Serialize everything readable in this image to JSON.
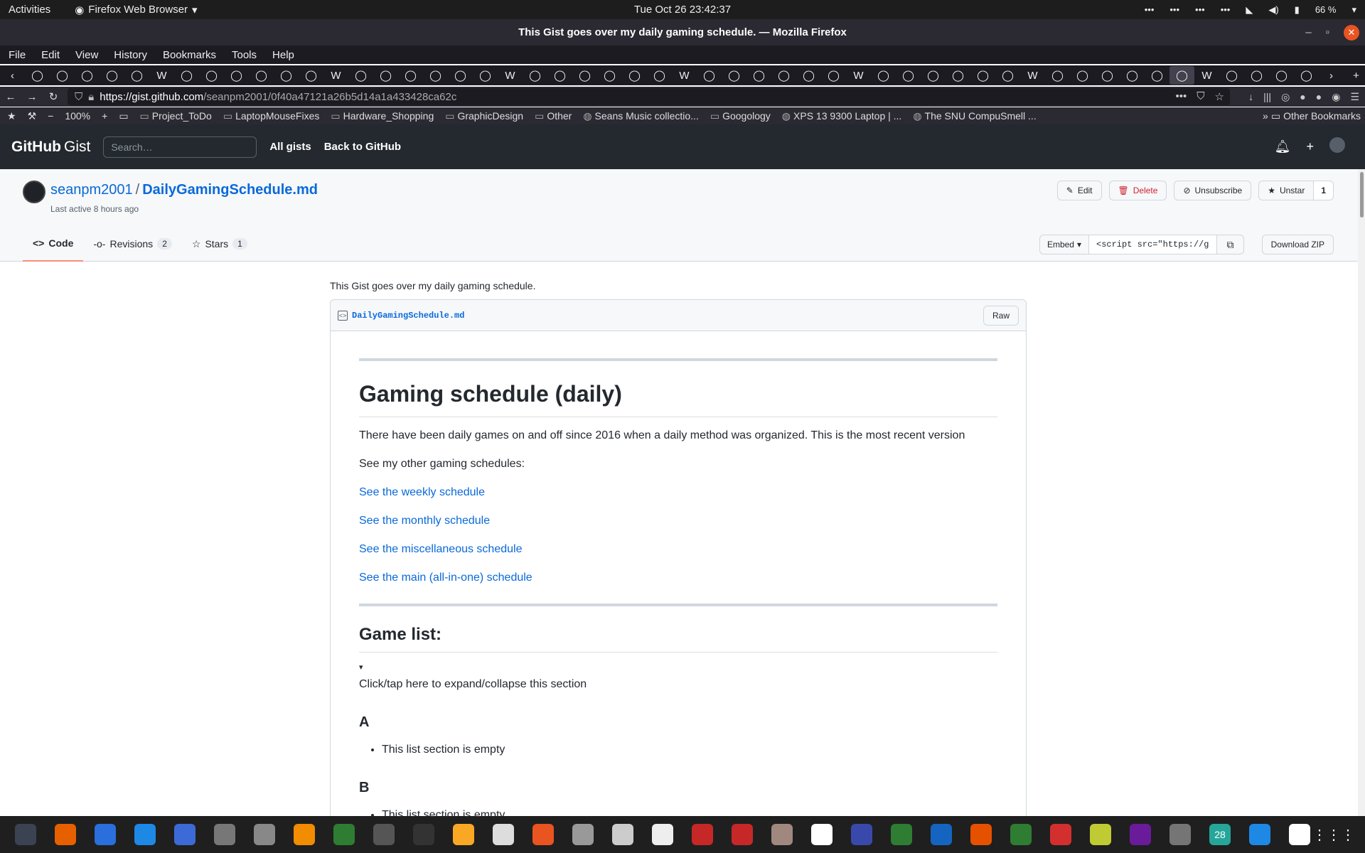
{
  "system": {
    "activities": "Activities",
    "app_name": "Firefox Web Browser",
    "clock": "Tue Oct 26  23:42:37",
    "battery": "66 %"
  },
  "window": {
    "title": "This Gist goes over my daily gaming schedule. — Mozilla Firefox"
  },
  "menu": [
    "File",
    "Edit",
    "View",
    "History",
    "Bookmarks",
    "Tools",
    "Help"
  ],
  "tabs": {
    "count_icons": 52,
    "active_index": 46
  },
  "navbar": {
    "url_host": "https://gist.github.com",
    "url_path": "/seanpm2001/0f40a47121a26b5d14a1a433428ca62c",
    "zoom": "100%"
  },
  "bookmarks": [
    "Project_ToDo",
    "LaptopMouseFixes",
    "Hardware_Shopping",
    "GraphicDesign",
    "Other",
    "Seans Music collectio...",
    "Googology",
    "XPS 13 9300 Laptop | ...",
    "The SNU CompuSmell ..."
  ],
  "other_bookmarks": "Other Bookmarks",
  "github": {
    "logo_main": "GitHub",
    "logo_sub": "Gist",
    "search_placeholder": "Search…",
    "nav": [
      "All gists",
      "Back to GitHub"
    ]
  },
  "gist": {
    "owner": "seanpm2001",
    "separator": "/",
    "filename": "DailyGamingSchedule.md",
    "last_active": "Last active 8 hours ago",
    "buttons": {
      "edit": "Edit",
      "delete": "Delete",
      "unsubscribe": "Unsubscribe",
      "unstar": "Unstar",
      "star_count": "1"
    },
    "tabs": {
      "code": "Code",
      "revisions": "Revisions",
      "revisions_count": "2",
      "stars": "Stars",
      "stars_count": "1"
    },
    "embed_label": "Embed",
    "embed_value": "<script src=\"https://g",
    "download_zip": "Download ZIP",
    "description": "This Gist goes over my daily gaming schedule.",
    "file_name_mono": "DailyGamingSchedule.md",
    "raw": "Raw"
  },
  "markdown": {
    "h1": "Gaming schedule (daily)",
    "intro": "There have been daily games on and off since 2016 when a daily method was organized. This is the most recent version",
    "see_other": "See my other gaming schedules:",
    "links": [
      "See the weekly schedule",
      "See the monthly schedule",
      "See the miscellaneous schedule",
      "See the main (all-in-one) schedule"
    ],
    "h2": "Game list:",
    "toggle_marker": "▾",
    "toggle_text": "Click/tap here to expand/collapse this section",
    "sections": [
      {
        "heading": "A",
        "item": "This list section is empty"
      },
      {
        "heading": "B",
        "item": "This list section is empty"
      }
    ]
  },
  "dock": {
    "apps": [
      "system-monitor",
      "firefox",
      "text-editor",
      "help",
      "notes",
      "files",
      "settings",
      "vlc",
      "image-viewer",
      "software-updater",
      "terminal",
      "calculator",
      "graph",
      "app-store",
      "search",
      "disk-usage",
      "reader",
      "screenshot",
      "text-app",
      "archive",
      "character-map",
      "tasks",
      "vim",
      "virtualbox",
      "updater",
      "spreadsheet",
      "alert",
      "game",
      "webcam",
      "tool",
      "calendar",
      "messenger",
      "music"
    ],
    "calendar_day": "28",
    "colors": [
      "#3b4252",
      "#e66000",
      "#2a6fdb",
      "#1e88e5",
      "#3c6ad6",
      "#777777",
      "#888888",
      "#f28c00",
      "#2e7d32",
      "#555555",
      "#333333",
      "#f9a825",
      "#dddddd",
      "#e95420",
      "#999999",
      "#cccccc",
      "#eeeeee",
      "#c62828",
      "#c62828",
      "#a1887f",
      "#ffffff",
      "#3949ab",
      "#2e7d32",
      "#1565c0",
      "#e65100",
      "#2e7d32",
      "#d32f2f",
      "#c0ca33",
      "#6a1b9a",
      "#757575",
      "#26a69a",
      "#1e88e5",
      "#ffffff"
    ]
  }
}
